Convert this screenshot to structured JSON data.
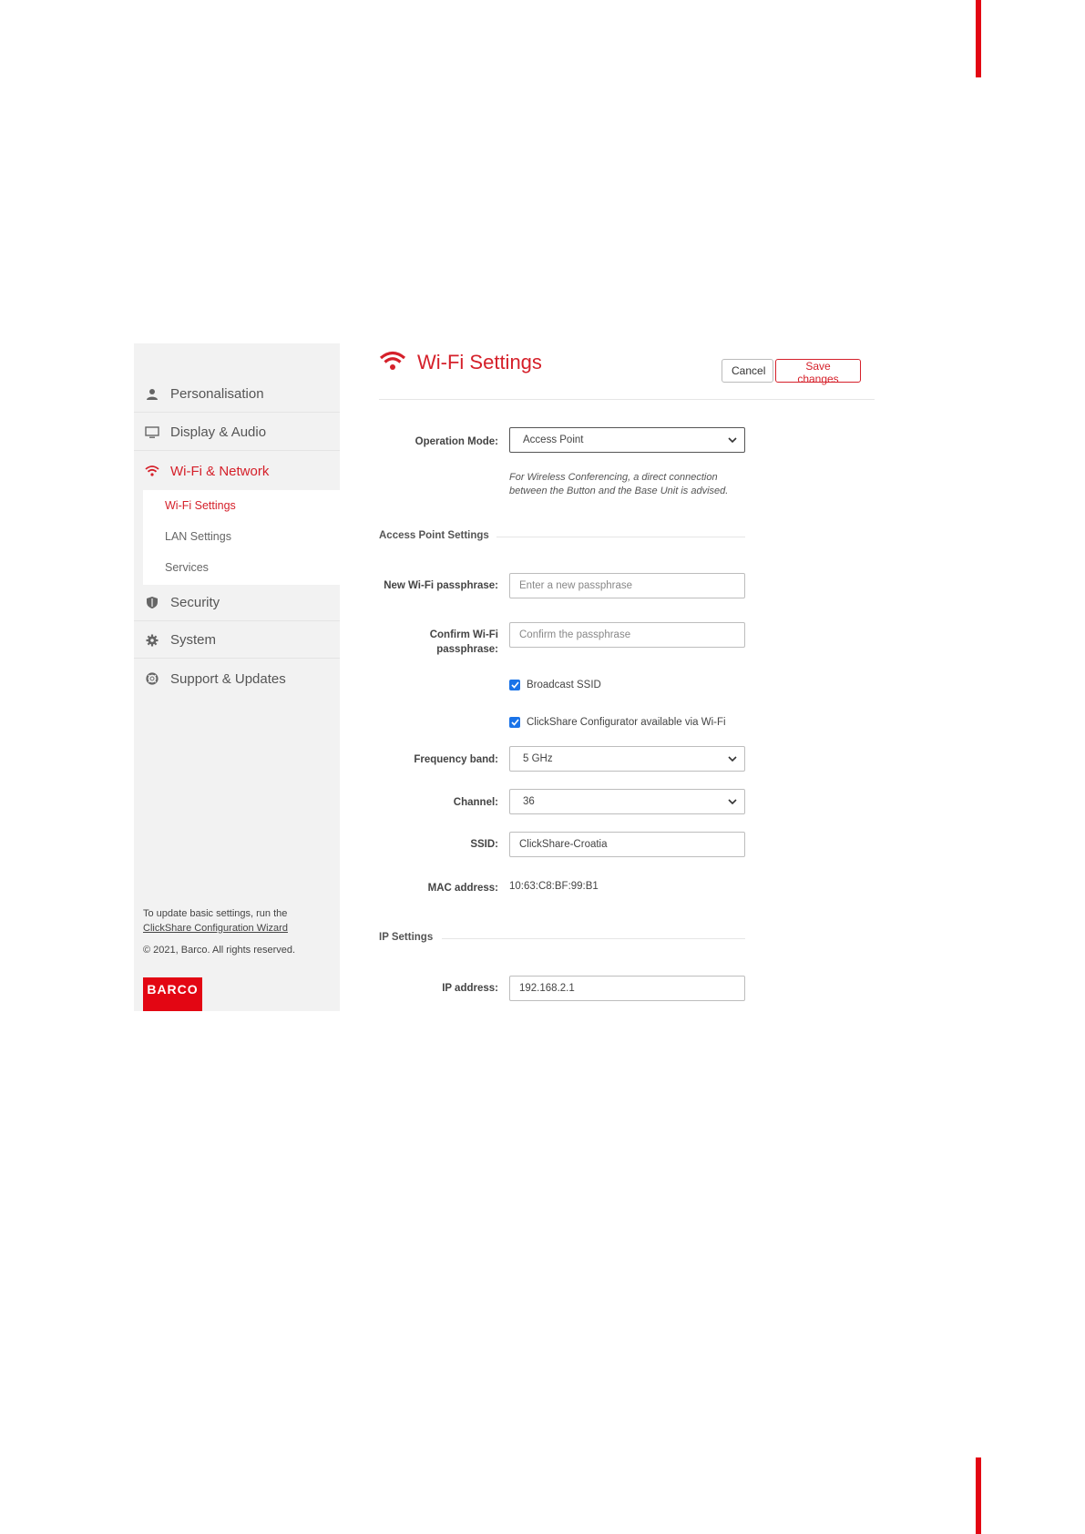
{
  "sidebar": {
    "items": [
      {
        "label": "Personalisation",
        "icon": "user-icon"
      },
      {
        "label": "Display & Audio",
        "icon": "monitor-icon"
      },
      {
        "label": "Wi-Fi & Network",
        "icon": "wifi-icon"
      },
      {
        "label": "Security",
        "icon": "shield-icon"
      },
      {
        "label": "System",
        "icon": "gear-icon"
      },
      {
        "label": "Support & Updates",
        "icon": "lifebuoy-icon"
      }
    ],
    "subitems": [
      {
        "label": "Wi-Fi Settings"
      },
      {
        "label": "LAN Settings"
      },
      {
        "label": "Services"
      }
    ],
    "footer": {
      "line1": "To update basic settings, run the",
      "link": "ClickShare Configuration Wizard",
      "copyright": "© 2021, Barco. All rights reserved.",
      "logo": "BARCO"
    }
  },
  "header": {
    "title": "Wi-Fi Settings",
    "cancel_label": "Cancel",
    "save_label": "Save changes"
  },
  "form": {
    "operation_mode": {
      "label": "Operation Mode:",
      "value": "Access Point"
    },
    "hint": "For Wireless Conferencing, a direct connection between the Button and the Base Unit is advised.",
    "ap_section": "Access Point Settings",
    "new_pass": {
      "label": "New Wi-Fi passphrase:",
      "placeholder": "Enter a new passphrase"
    },
    "confirm_pass": {
      "label": "Confirm Wi-Fi passphrase:",
      "placeholder": "Confirm the passphrase"
    },
    "broadcast_ssid": {
      "label": "Broadcast SSID",
      "checked": true
    },
    "configurator_wifi": {
      "label": "ClickShare Configurator available via Wi-Fi",
      "checked": true
    },
    "frequency": {
      "label": "Frequency band:",
      "value": "5 GHz"
    },
    "channel": {
      "label": "Channel:",
      "value": "36"
    },
    "ssid": {
      "label": "SSID:",
      "value": "ClickShare-Croatia"
    },
    "mac": {
      "label": "MAC address:",
      "value": "10:63:C8:BF:99:B1"
    },
    "ip_section": "IP Settings",
    "ip": {
      "label": "IP address:",
      "value": "192.168.2.1"
    }
  },
  "colors": {
    "accent": "#d5202a",
    "brand": "#e30613",
    "checkbox": "#1a73e8"
  }
}
